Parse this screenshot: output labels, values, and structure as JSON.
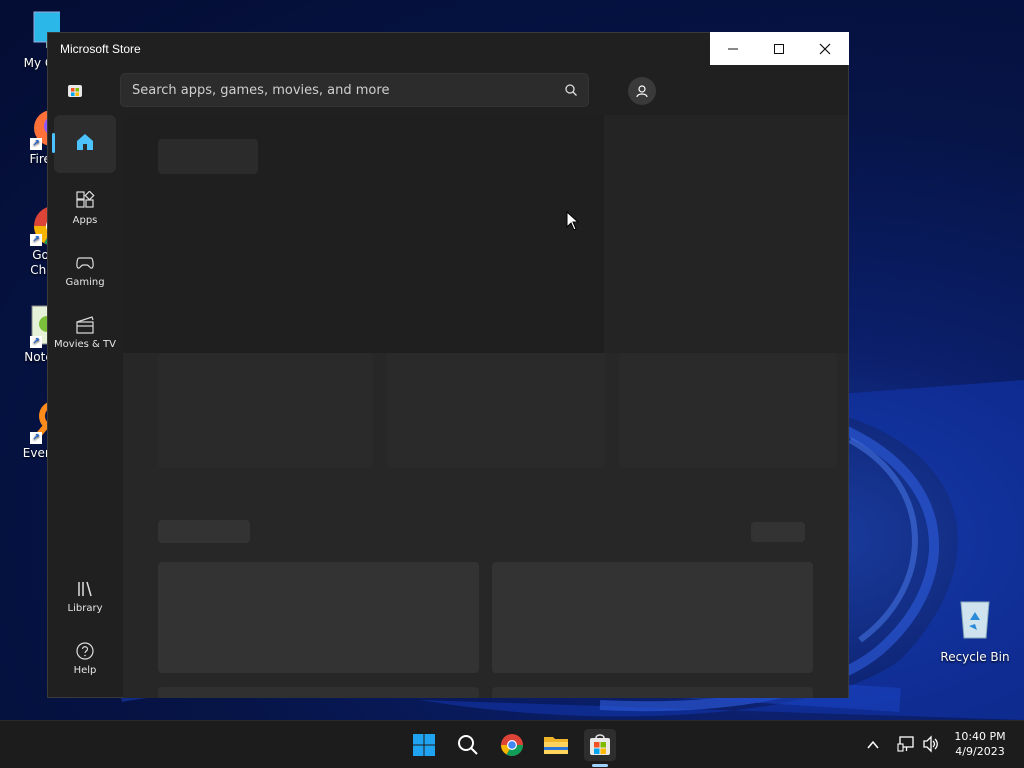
{
  "window": {
    "title": "Microsoft Store",
    "controls": {
      "minimize_icon": "minimize-icon",
      "maximize_icon": "maximize-icon",
      "close_icon": "close-icon"
    }
  },
  "search": {
    "placeholder": "Search apps, games, movies, and more"
  },
  "nav": {
    "items": [
      {
        "label": "",
        "icon": "home-icon"
      },
      {
        "label": "Apps",
        "icon": "apps-icon"
      },
      {
        "label": "Gaming",
        "icon": "gaming-icon"
      },
      {
        "label": "Movies & TV",
        "icon": "movies-icon"
      }
    ],
    "bottom": [
      {
        "label": "Library",
        "icon": "library-icon"
      },
      {
        "label": "Help",
        "icon": "help-icon"
      }
    ]
  },
  "desktop": {
    "icons": [
      {
        "label": "My Com",
        "icon": "computer-icon"
      },
      {
        "label": "Firefo",
        "icon": "firefox-icon"
      },
      {
        "label": "Goog Chron",
        "icon": "chrome-icon"
      },
      {
        "label": "Notepa",
        "icon": "notepad-icon"
      },
      {
        "label": "Everyth",
        "icon": "everything-icon"
      },
      {
        "label": "Recycle Bin",
        "icon": "recycle-bin-icon"
      }
    ]
  },
  "taskbar": {
    "time": "10:40 PM",
    "date": "4/9/2023"
  },
  "colors": {
    "accent": "#4cc2ff",
    "window_bg": "#202020",
    "content_bg": "#272727"
  }
}
